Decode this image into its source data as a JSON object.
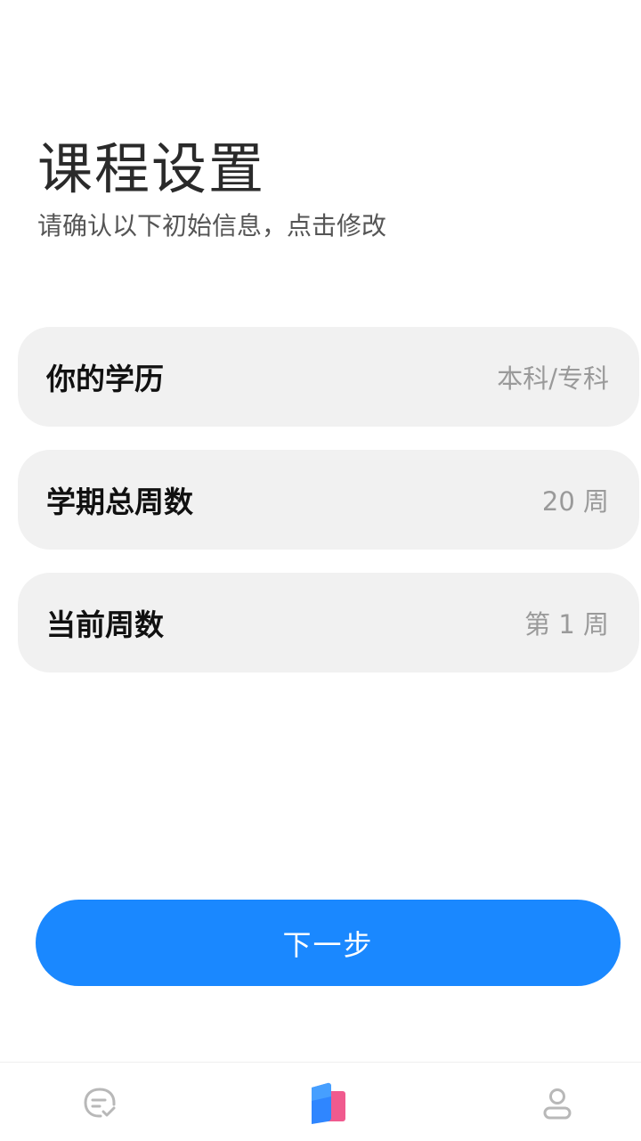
{
  "header": {
    "title": "课程设置",
    "subtitle": "请确认以下初始信息，点击修改"
  },
  "settings": [
    {
      "label": "你的学历",
      "value": "本科/专科"
    },
    {
      "label": "学期总周数",
      "value": "20 周"
    },
    {
      "label": "当前周数",
      "value": "第 1 周"
    }
  ],
  "actions": {
    "next_label": "下一步"
  },
  "bottom_nav": {
    "items": [
      {
        "icon": "todo-check-icon"
      },
      {
        "icon": "schedule-book-icon"
      },
      {
        "icon": "profile-icon"
      }
    ]
  },
  "colors": {
    "primary": "#1a88ff",
    "card_bg": "#f1f1f1",
    "value_text": "#9a9a9a",
    "icon_gray": "#b8b8b8"
  }
}
